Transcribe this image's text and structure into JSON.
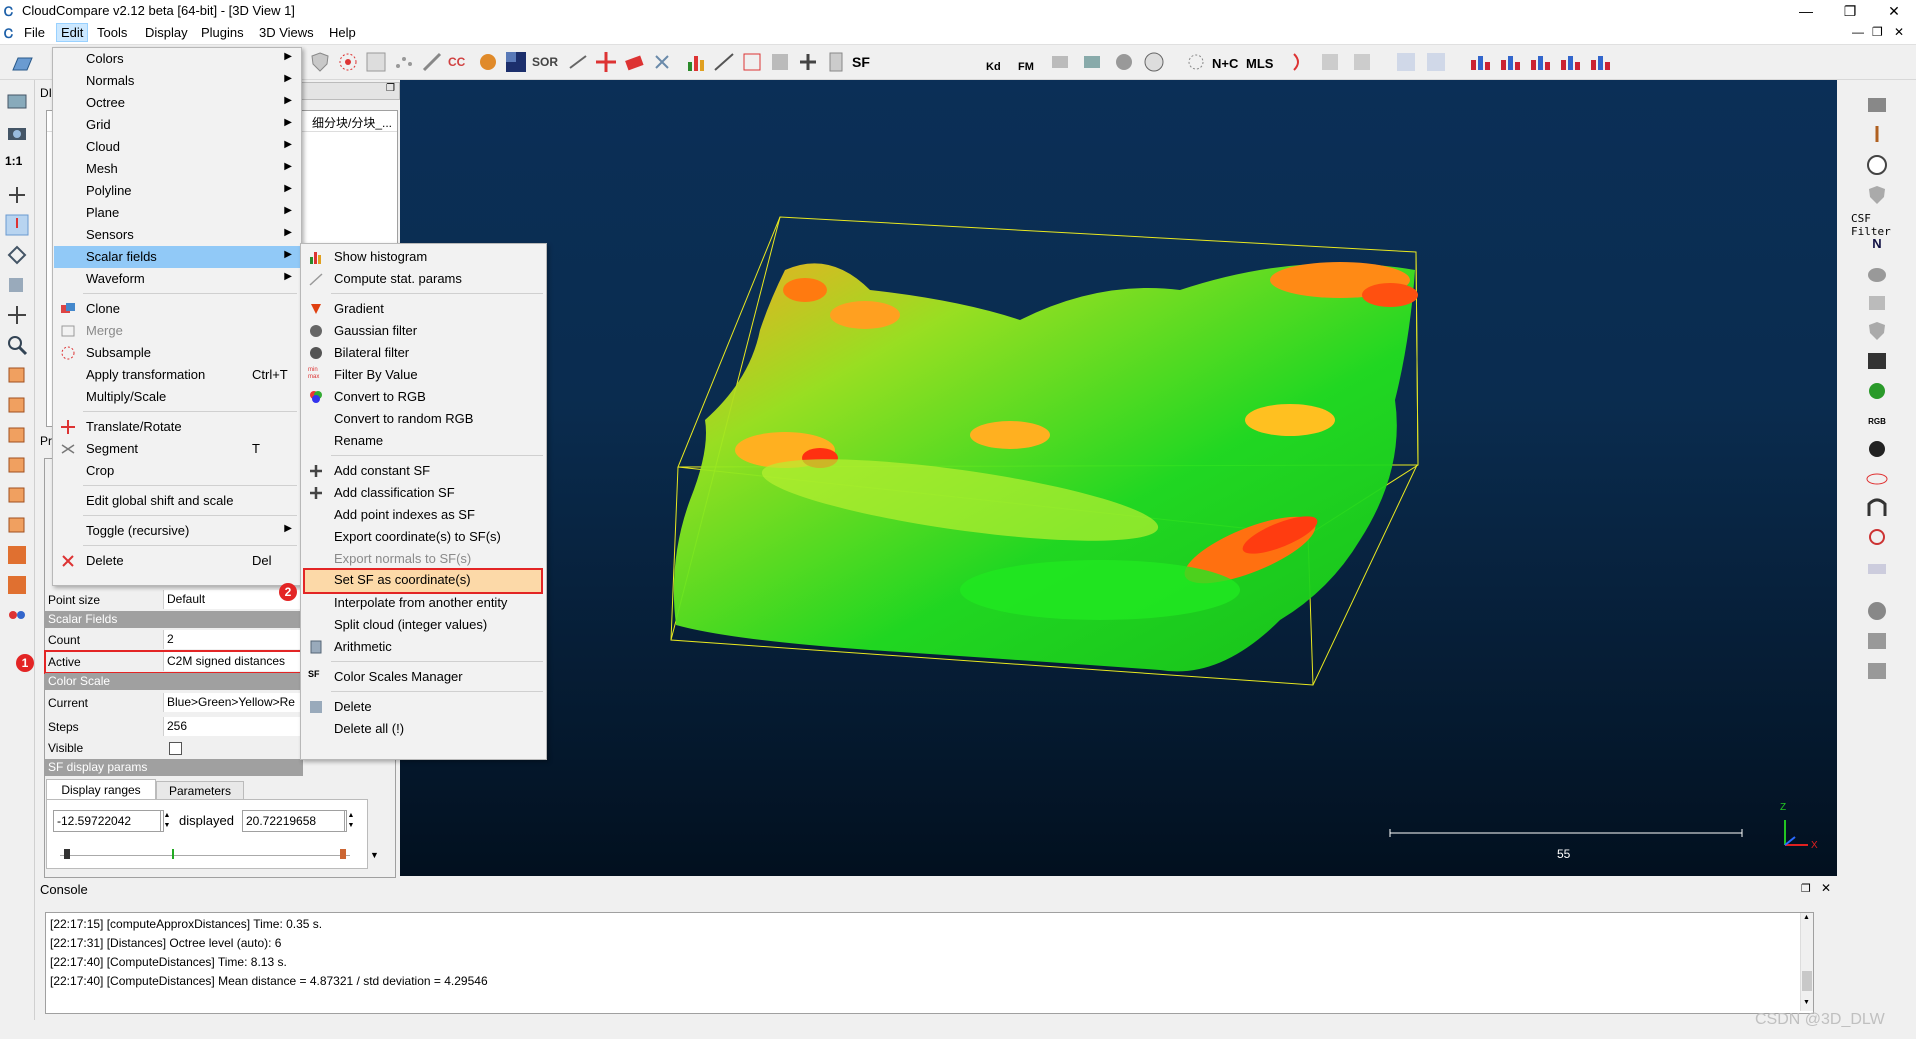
{
  "window": {
    "title": "CloudCompare v2.12 beta [64-bit] - [3D View 1]",
    "min_glyph": "—",
    "max_glyph": "❐",
    "close_glyph": "✕"
  },
  "menubar": [
    "File",
    "Edit",
    "Tools",
    "Display",
    "Plugins",
    "3D Views",
    "Help"
  ],
  "toolbar": {
    "labels": {
      "cc": "CC",
      "sor": "SOR",
      "sf": "SF",
      "kd": "Kd",
      "fm": "FM",
      "nc": "N+C",
      "mls": "MLS"
    }
  },
  "db_tree": {
    "tab_label": "DI",
    "header_label": "细分块/分块_..."
  },
  "properties": {
    "tab_label": "Pr",
    "point_size": {
      "label": "Point size",
      "value": "Default"
    },
    "scalar_fields_header": "Scalar Fields",
    "count": {
      "label": "Count",
      "value": "2"
    },
    "active": {
      "label": "Active",
      "value": "C2M signed distances"
    },
    "color_scale_header": "Color Scale",
    "current": {
      "label": "Current",
      "value": "Blue>Green>Yellow>Re"
    },
    "steps": {
      "label": "Steps",
      "value": "256"
    },
    "visible": {
      "label": "Visible"
    },
    "sf_display_header": "SF display params",
    "tabs": [
      "Display ranges",
      "Parameters"
    ],
    "range_min": "-12.59722042",
    "displayed_label": "displayed",
    "range_max": "20.72219658"
  },
  "edit_menu": {
    "items": [
      {
        "label": "Colors",
        "submenu": true
      },
      {
        "label": "Normals",
        "submenu": true
      },
      {
        "label": "Octree",
        "submenu": true
      },
      {
        "label": "Grid",
        "submenu": true
      },
      {
        "label": "Cloud",
        "submenu": true
      },
      {
        "label": "Mesh",
        "submenu": true
      },
      {
        "label": "Polyline",
        "submenu": true
      },
      {
        "label": "Plane",
        "submenu": true
      },
      {
        "label": "Sensors",
        "submenu": true
      },
      {
        "label": "Scalar fields",
        "submenu": true
      },
      {
        "label": "Waveform",
        "submenu": true
      },
      {
        "label": "Clone"
      },
      {
        "label": "Merge"
      },
      {
        "label": "Subsample"
      },
      {
        "label": "Apply transformation",
        "shortcut": "Ctrl+T"
      },
      {
        "label": "Multiply/Scale"
      },
      {
        "label": "Translate/Rotate"
      },
      {
        "label": "Segment",
        "shortcut": "T"
      },
      {
        "label": "Crop"
      },
      {
        "label": "Edit global shift and scale"
      },
      {
        "label": "Toggle (recursive)",
        "submenu": true
      },
      {
        "label": "Delete",
        "shortcut": "Del"
      }
    ]
  },
  "scalar_fields_menu": {
    "items": [
      "Show histogram",
      "Compute stat. params",
      "Gradient",
      "Gaussian filter",
      "Bilateral filter",
      "Filter By Value",
      "Convert to RGB",
      "Convert to random RGB",
      "Rename",
      "Add constant SF",
      "Add classification SF",
      "Add point indexes as SF",
      "Export coordinate(s) to SF(s)",
      "Export normals to SF(s)",
      "Set SF as coordinate(s)",
      "Interpolate from another entity",
      "Split cloud (integer values)",
      "Arithmetic",
      "Color Scales Manager",
      "Delete",
      "Delete all (!)"
    ],
    "icon_labels": {
      "filter": "min max",
      "csm": "SF"
    }
  },
  "annotations": {
    "badge1": "1",
    "badge2": "2"
  },
  "view3d": {
    "scale_label": "55",
    "axis_z": "Z",
    "axis_x": "X"
  },
  "right_toolbar": {
    "csf_label": "CSF Filter",
    "n_label": "N",
    "rgb_label": "RGB"
  },
  "console": {
    "title": "Console",
    "lines": [
      "[22:17:15] [computeApproxDistances] Time: 0.35 s.",
      "[22:17:31] [Distances] Octree level (auto): 6",
      "[22:17:40] [ComputeDistances] Time: 8.13 s.",
      "[22:17:40] [ComputeDistances] Mean distance = 4.87321 / std deviation = 4.29546"
    ]
  },
  "watermark": "CSDN @3D_DLW",
  "colors": {
    "accent": "#e32525",
    "menu_highlight": "#91c9f7",
    "view_bg": "#0a2c4f"
  }
}
